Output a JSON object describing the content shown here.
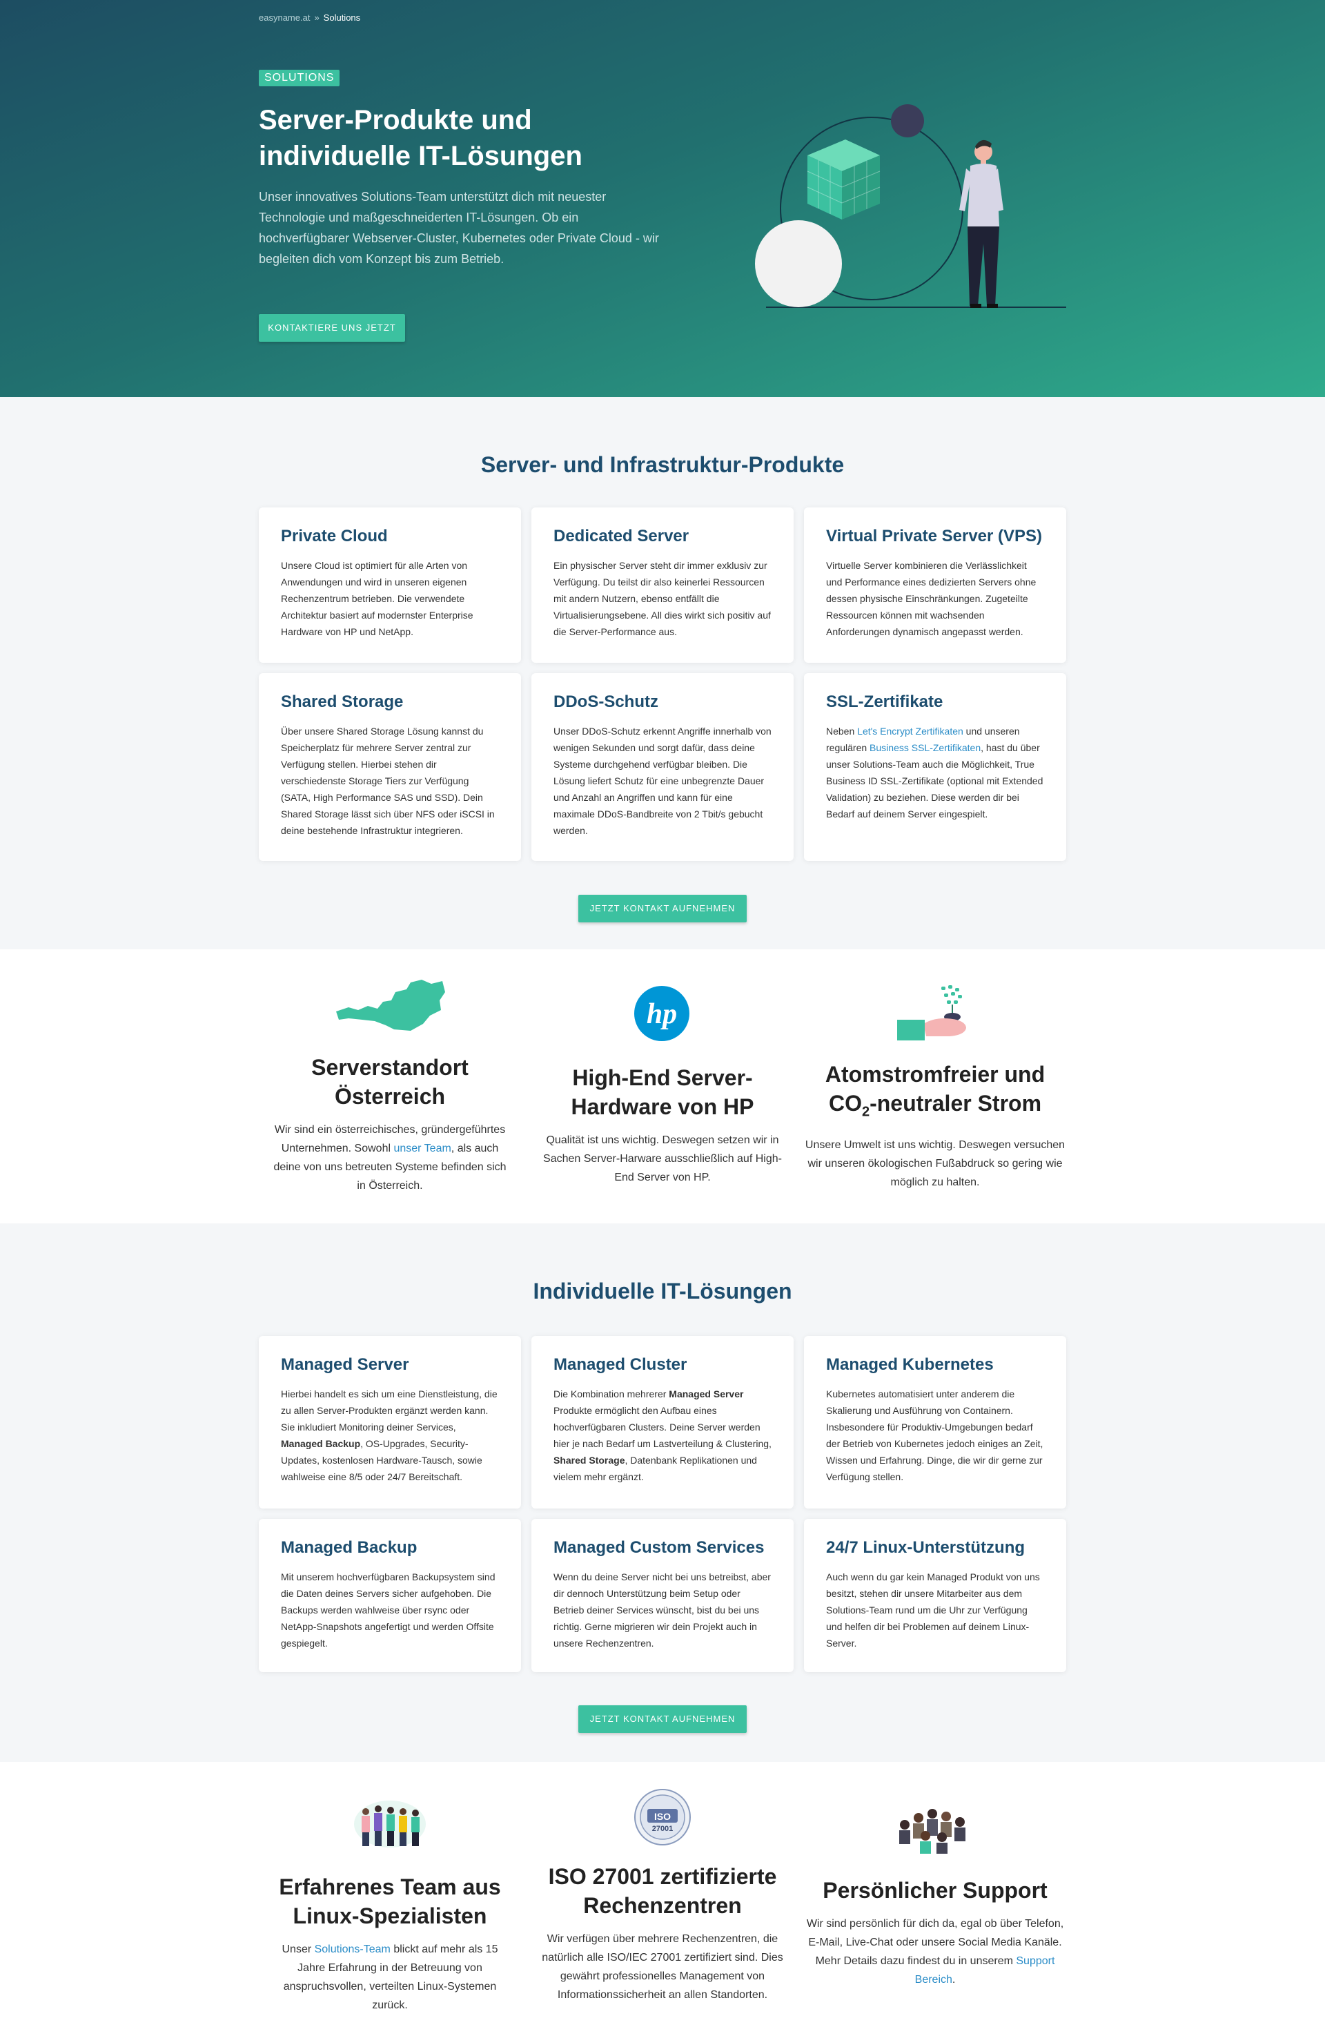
{
  "breadcrumb": {
    "home": "easyname.at",
    "separator": "»",
    "current": "Solutions"
  },
  "hero": {
    "badge": "SOLUTIONS",
    "title_line1": "Server-Produkte und",
    "title_line2": "individuelle IT-Lösungen",
    "text": "Unser innovatives Solutions-Team unterstützt dich mit neuester Technologie und maßgeschneiderten IT-Lösungen. Ob ein hochverfügbarer Webserver-Cluster, Kubernetes oder Private Cloud - wir begleiten dich vom Konzept bis zum Betrieb.",
    "button": "KONTAKTIERE UNS JETZT"
  },
  "products": {
    "title": "Server- und Infrastruktur-Produkte",
    "cards": [
      {
        "title": "Private Cloud",
        "text": "Unsere Cloud ist optimiert für alle Arten von Anwendungen und wird in unseren eigenen Rechenzentrum betrieben. Die verwendete Architektur basiert auf modernster Enterprise Hardware von HP und NetApp."
      },
      {
        "title": "Dedicated Server",
        "text": "Ein physischer Server steht dir immer exklusiv zur Verfügung. Du teilst dir also keinerlei Ressourcen mit andern Nutzern, ebenso entfällt die Virtualisierungsebene. All dies wirkt sich positiv auf die Server-Performance aus."
      },
      {
        "title": "Virtual Private Server (VPS)",
        "text": "Virtuelle Server kombinieren die Verlässlichkeit und Performance eines dedizierten Servers ohne dessen physische Einschränkungen. Zugeteilte Ressourcen können mit wachsenden Anforderungen dynamisch angepasst werden."
      },
      {
        "title": "Shared Storage",
        "text": "Über unsere Shared Storage Lösung kannst du Speicherplatz für mehrere Server zentral zur Verfügung stellen. Hierbei stehen dir verschiedenste Storage Tiers zur Verfügung (SATA, High Performance SAS und SSD). Dein Shared Storage lässt sich über NFS oder iSCSI in deine bestehende Infrastruktur integrieren."
      },
      {
        "title": "DDoS-Schutz",
        "text": "Unser DDoS-Schutz erkennt Angriffe innerhalb von wenigen Sekunden und sorgt dafür, dass deine Systeme durchgehend verfügbar bleiben. Die Lösung liefert Schutz für eine unbegrenzte Dauer und Anzahl an Angriffen und kann für eine maximale DDoS-Bandbreite von 2 Tbit/s gebucht werden."
      },
      {
        "title": "SSL-Zertifikate",
        "pre": "Neben ",
        "link1": "Let's Encrypt Zertifikaten",
        "mid": " und unseren regulären ",
        "link2": "Business SSL-Zertifikaten",
        "post": ", hast du über unser Solutions-Team auch die Möglichkeit, True Business ID SSL-Zertifikate (optional mit Extended Validation) zu beziehen. Diese werden dir bei Bedarf auf deinem Server eingespielt."
      }
    ],
    "button": "JETZT KONTAKT AUFNEHMEN"
  },
  "features1": [
    {
      "icon": "austria-map-icon",
      "title_line1": "Serverstandort",
      "title_line2": "Österreich",
      "pre": "Wir sind ein österreichisches, gründergeführtes Unternehmen. Sowohl ",
      "link": "unser Team",
      "post": ", als auch deine von uns betreuten Systeme befinden sich in Österreich."
    },
    {
      "icon": "hp-logo-icon",
      "logo_text": "hp",
      "title_line1": "High-End Server-",
      "title_line2": "Hardware von HP",
      "text": "Qualität ist uns wichtig. Deswegen setzen wir in Sachen Server-Harware ausschließlich auf High-End Server von HP."
    },
    {
      "icon": "plant-hand-icon",
      "title_line1": "Atomstromfreier und",
      "title_line2_pre": "CO",
      "title_line2_sub": "2",
      "title_line2_post": "-neutraler Strom",
      "text": "Unsere Umwelt ist uns wichtig. Deswegen versuchen wir unseren ökologischen Fußabdruck so gering wie möglich zu halten."
    }
  ],
  "solutions": {
    "title": "Individuelle IT-Lösungen",
    "cards": [
      {
        "title": "Managed Server",
        "t1": "Hierbei handelt es sich um eine Dienstleistung, die zu allen Server-Produkten ergänzt werden kann. Sie inkludiert Monitoring deiner Services, ",
        "b1": "Managed Backup",
        "t2": ", OS-Upgrades, Security-Updates, kostenlosen Hardware-Tausch, sowie wahlweise eine 8/5 oder 24/7 Bereitschaft."
      },
      {
        "title": "Managed Cluster",
        "t1": "Die Kombination mehrerer ",
        "b1": "Managed Server",
        "t2": " Produkte ermöglicht den Aufbau eines hochverfügbaren Clusters. Deine Server werden hier je nach Bedarf um Lastverteilung & Clustering, ",
        "b2": "Shared Storage",
        "t3": ", Datenbank Replikationen und vielem mehr ergänzt."
      },
      {
        "title": "Managed Kubernetes",
        "text": "Kubernetes automatisiert unter anderem die Skalierung und Ausführung von Containern. Insbesondere für Produktiv-Umgebungen bedarf der Betrieb von Kubernetes jedoch einiges an Zeit, Wissen und Erfahrung. Dinge, die wir dir gerne zur Verfügung stellen."
      },
      {
        "title": "Managed Backup",
        "text": "Mit unserem hochverfügbaren Backupsystem sind die Daten deines Servers sicher aufgehoben. Die Backups werden wahlweise über rsync oder NetApp-Snapshots angefertigt und werden Offsite gespiegelt."
      },
      {
        "title": "Managed Custom Services",
        "text": "Wenn du deine Server nicht bei uns betreibst, aber dir dennoch Unterstützung beim Setup oder Betrieb deiner Services wünscht, bist du bei uns richtig. Gerne migrieren wir dein Projekt auch in unsere Rechenzentren."
      },
      {
        "title": "24/7 Linux-Unterstützung",
        "text": "Auch wenn du gar kein Managed Produkt von uns besitzt, stehen dir unsere Mitarbeiter aus dem Solutions-Team rund um die Uhr zur Verfügung und helfen dir bei Problemen auf deinem Linux-Server."
      }
    ],
    "button": "JETZT KONTAKT AUFNEHMEN"
  },
  "features2": [
    {
      "icon": "team-illustration-icon",
      "title_line1": "Erfahrenes Team aus",
      "title_line2": "Linux-Spezialisten",
      "pre": "Unser ",
      "link": "Solutions-Team",
      "post": " blickt auf mehr als 15 Jahre Erfahrung in der Betreuung von anspruchsvollen, verteilten Linux-Systemen zurück."
    },
    {
      "icon": "iso-27001-badge-icon",
      "badge_top": "ISO",
      "badge_num": "27001",
      "title_line1": "ISO 27001 zertifizierte",
      "title_line2": "Rechenzentren",
      "text": "Wir verfügen über mehrere Rechenzentren, die natürlich alle ISO/IEC 27001 zertifiziert sind. Dies gewährt professionelles Management von Informationssicherheit an allen Standorten."
    },
    {
      "icon": "support-team-icon",
      "title_line1": "Persönlicher Support",
      "pre": "Wir sind persönlich für dich da, egal ob über Telefon, E-Mail, Live-Chat oder unsere Social Media Kanäle. Mehr Details dazu findest du in unserem ",
      "link": "Support Bereich",
      "post": "."
    }
  ],
  "colors": {
    "accent": "#3cc1a0",
    "heading": "#1d4d6e",
    "link": "#2a8cc7",
    "hero_dark": "#1d4d62",
    "hero_light": "#2fab8c"
  }
}
